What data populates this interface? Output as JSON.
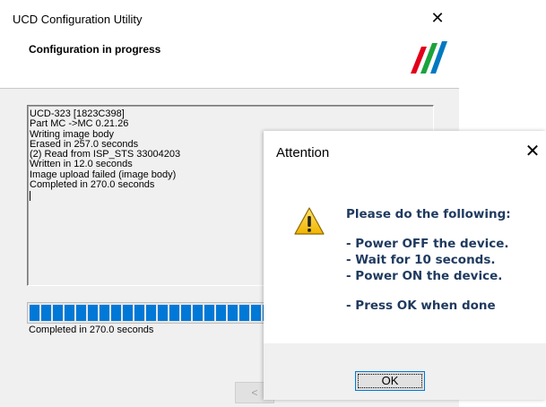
{
  "main_window": {
    "title": "UCD Configuration Utility",
    "close_glyph": "✕",
    "subtitle": "Configuration in progress",
    "log_lines": [
      "UCD-323 [1823C398]",
      "Part MC ->MC 0.21.26",
      "Writing image body",
      "Erased in 257.0 seconds",
      "(2) Read from ISP_STS 33004203",
      "Written in 12.0 seconds",
      "Image upload failed (image body)",
      "Completed in 270.0 seconds"
    ],
    "progress_status": "Completed in 270.0 seconds",
    "back_button_label": "<",
    "logo_colors": [
      "#e2001a",
      "#1aa33c",
      "#0079c1"
    ],
    "progress_color": "#0078d7"
  },
  "dialog": {
    "title": "Attention",
    "close_glyph": "✕",
    "icon": "warning-icon",
    "heading": "Please do the following:",
    "steps": [
      "- Power OFF the device.",
      "- Wait for 10 seconds.",
      "- Power ON the device."
    ],
    "final_step": "- Press OK when done",
    "ok_label": "OK"
  }
}
